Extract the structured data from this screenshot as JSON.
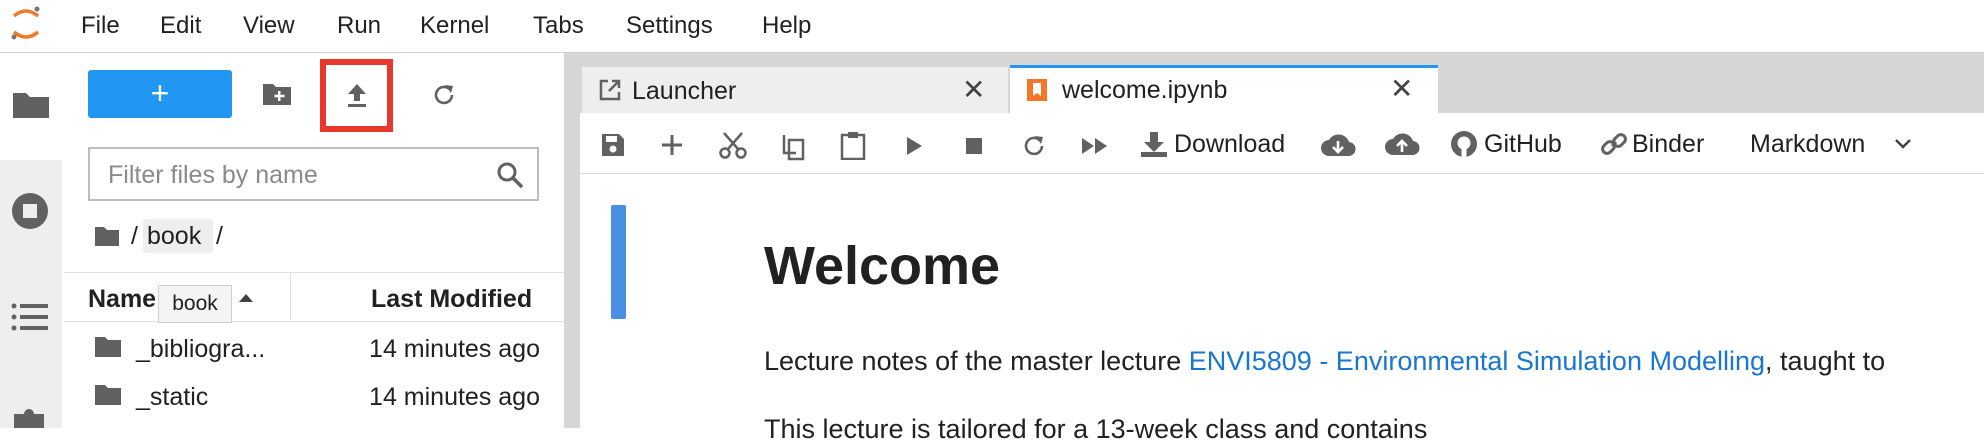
{
  "menu": [
    "File",
    "Edit",
    "View",
    "Run",
    "Kernel",
    "Tabs",
    "Settings",
    "Help"
  ],
  "filebrowser": {
    "new_label": "+",
    "filter_placeholder": "Filter files by name",
    "breadcrumb": {
      "root": "/",
      "folder": "book",
      "sep": "/"
    },
    "columns": {
      "name": "Name",
      "modified": "Last Modified"
    },
    "tooltip": "book",
    "items": [
      {
        "name": "_bibliogra...",
        "modified": "14 minutes ago"
      },
      {
        "name": "_static",
        "modified": "14 minutes ago"
      }
    ]
  },
  "tabs": [
    {
      "label": "Launcher"
    },
    {
      "label": "welcome.ipynb"
    }
  ],
  "toolbar": {
    "download": "Download",
    "github": "GitHub",
    "binder": "Binder",
    "cell_type": "Markdown"
  },
  "notebook": {
    "heading": "Welcome",
    "para1_prefix": "Lecture notes of the master lecture ",
    "para1_link": "ENVI5809 - Environmental Simulation Modelling",
    "para1_suffix": ", taught to",
    "para2_partial": "This lecture is tailored for a 13-week class and contains"
  },
  "colors": {
    "accent": "#2196f3",
    "highlight": "#e8382b",
    "link": "#1976d2"
  }
}
